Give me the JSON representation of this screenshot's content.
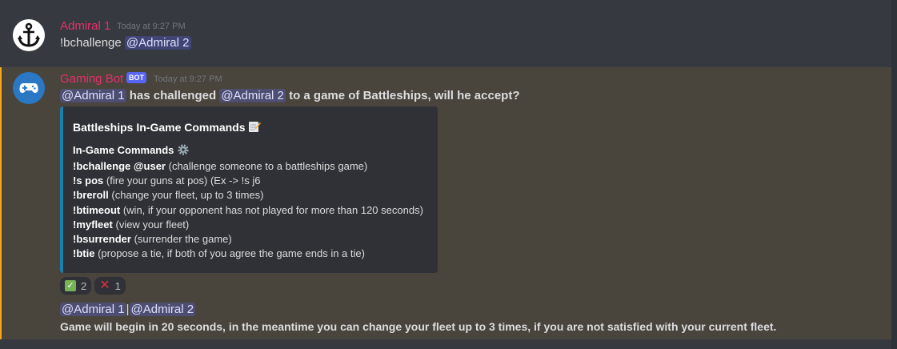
{
  "messages": [
    {
      "author": "Admiral 1",
      "timestamp": "Today at 9:27 PM",
      "avatar_icon": "anchor-icon",
      "content_text": "!bchallenge",
      "content_mention": "@Admiral 2"
    },
    {
      "author": "Gaming Bot",
      "bot_tag": "BOT",
      "timestamp": "Today at 9:27 PM",
      "avatar_icon": "gamepad-icon",
      "line1": {
        "mention1": "@Admiral 1",
        "text1": "has challenged",
        "mention2": "@Admiral 2",
        "text2": "to a game of Battleships, will he accept?"
      },
      "embed": {
        "accent_color": "#1d7fae",
        "title": "Battleships In-Game Commands",
        "title_icon": "memo-icon",
        "field_name": "In-Game Commands",
        "field_icon": "gear-icon",
        "commands": [
          {
            "cmd": "!bchallenge @user",
            "desc": "(challenge someone to a battleships game)"
          },
          {
            "cmd": "!s pos",
            "desc": "(fire your guns at pos) (Ex -> !s j6"
          },
          {
            "cmd": "!breroll",
            "desc": "(change your fleet, up to 3 times)"
          },
          {
            "cmd": "!btimeout",
            "desc": "(win, if your opponent has not played for more than 120 seconds)"
          },
          {
            "cmd": "!myfleet",
            "desc": "(view your fleet)"
          },
          {
            "cmd": "!bsurrender",
            "desc": "(surrender the game)"
          },
          {
            "cmd": "!btie",
            "desc": "(propose a tie, if both of you agree the game ends in a tie)"
          }
        ]
      },
      "reactions": [
        {
          "emoji": "check-mark-icon",
          "count": "2"
        },
        {
          "emoji": "cross-mark-icon",
          "count": "1"
        }
      ],
      "line3": {
        "mention1": "@Admiral 1",
        "separator": "|",
        "mention2": "@Admiral 2"
      },
      "line4": "Game will begin in 20 seconds, in the meantime you can change your fleet up to 3 times, if you are not satisfied with your current fleet."
    }
  ],
  "colors": {
    "background": "#36393f",
    "highlight": "#49443c",
    "highlight_border": "#faa61a",
    "username": "#e5316b",
    "bot_tag": "#5865f2"
  }
}
